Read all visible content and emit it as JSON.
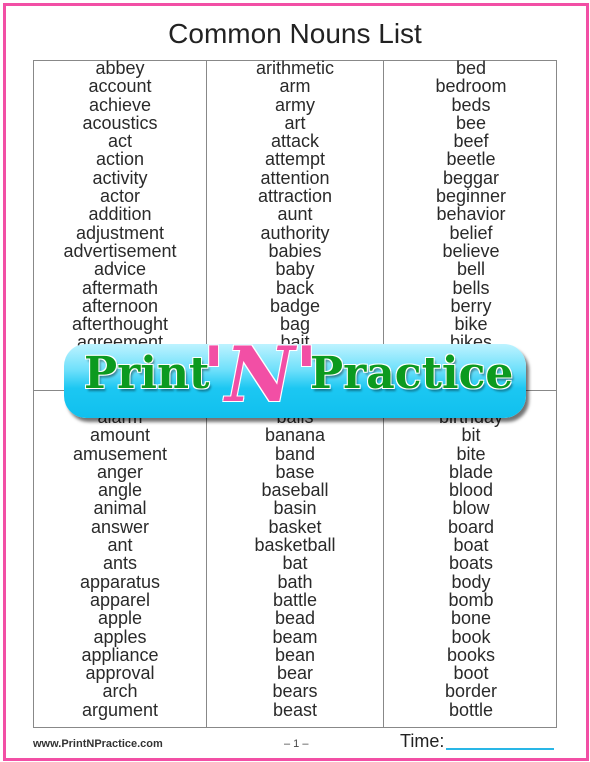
{
  "title": "Common Nouns List",
  "columns_top": [
    [
      "abbey",
      "account",
      "achieve",
      "acoustics",
      "act",
      "action",
      "activity",
      "actor",
      "addition",
      "adjustment",
      "advertisement",
      "advice",
      "aftermath",
      "afternoon",
      "afterthought",
      "agreement"
    ],
    [
      "arithmetic",
      "arm",
      "army",
      "art",
      "attack",
      "attempt",
      "attention",
      "attraction",
      "aunt",
      "authority",
      "babies",
      "baby",
      "back",
      "badge",
      "bag",
      "bait"
    ],
    [
      "bed",
      "bedroom",
      "beds",
      "bee",
      "beef",
      "beetle",
      "beggar",
      "beginner",
      "behavior",
      "belief",
      "believe",
      "bell",
      "bells",
      "berry",
      "bike",
      "bikes"
    ]
  ],
  "columns_bottom": [
    [
      "alarm",
      "amount",
      "amusement",
      "anger",
      "angle",
      "animal",
      "answer",
      "ant",
      "ants",
      "apparatus",
      "apparel",
      "apple",
      "apples",
      "appliance",
      "approval",
      "arch",
      "argument"
    ],
    [
      "balls",
      "banana",
      "band",
      "base",
      "baseball",
      "basin",
      "basket",
      "basketball",
      "bat",
      "bath",
      "battle",
      "bead",
      "beam",
      "bean",
      "bear",
      "bears",
      "beast"
    ],
    [
      "birthday",
      "bit",
      "bite",
      "blade",
      "blood",
      "blow",
      "board",
      "boat",
      "boats",
      "body",
      "bomb",
      "bone",
      "book",
      "books",
      "boot",
      "border",
      "bottle"
    ]
  ],
  "banner": {
    "left": "Print",
    "middle": "'N'",
    "right": "Practice"
  },
  "footer": {
    "site": "www.PrintNPractice.com",
    "page": "– 1 –",
    "time_label": "Time:"
  },
  "colors": {
    "frame": "#f24fa5",
    "banner_text": "#0c9a1f",
    "banner_n": "#f24fa5",
    "banner_bg": "#10c0ee",
    "time_line": "#29b6e6"
  }
}
